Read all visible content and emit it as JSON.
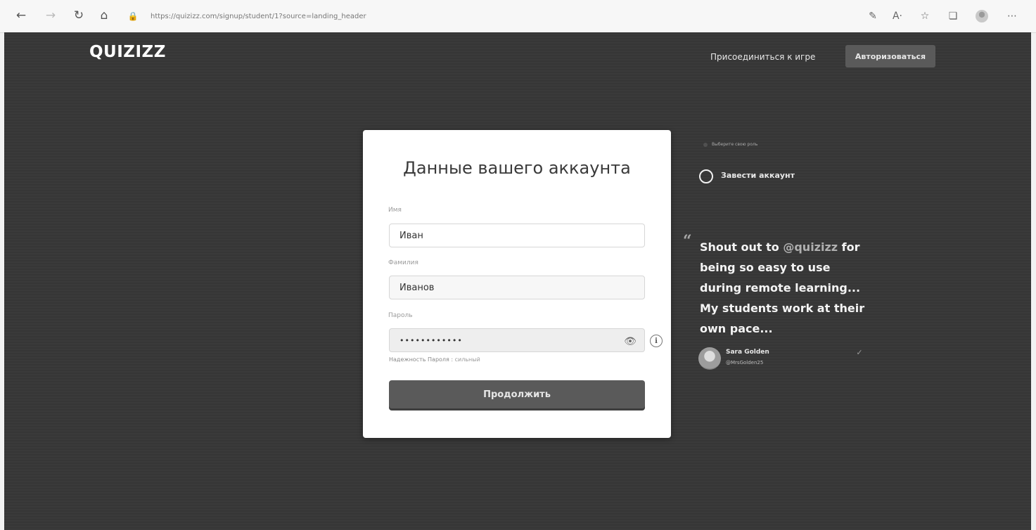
{
  "browser": {
    "url": "https://quizizz.com/signup/student/1?source=landing_header",
    "nav": {
      "back_icon": "arrow-left-icon",
      "forward_icon": "arrow-right-icon",
      "refresh_icon": "refresh-icon",
      "home_icon": "home-icon"
    },
    "toolbar_icons": [
      "pen-icon",
      "read-aloud-icon",
      "favorites-icon",
      "collections-icon",
      "profile-icon",
      "more-icon"
    ]
  },
  "header": {
    "logo": "QUIZIZZ",
    "join_link": "Присоединиться к игре",
    "login_button": "Авторизоваться"
  },
  "form": {
    "title": "Данные вашего аккаунта",
    "first_name_label": "Имя",
    "first_name_value": "Иван",
    "last_name_label": "Фамилия",
    "last_name_value": "Иванов",
    "password_label": "Пароль",
    "password_value": "••••••••••••",
    "strength_label": "Надежность Пароля :",
    "strength_value": "сильный",
    "continue_button": "Продолжить"
  },
  "steps": {
    "previous_step": "Выберите свою роль",
    "current_step": "Завести аккаунт"
  },
  "testimonial": {
    "quote_before": "Shout out to",
    "mention": "@quizizz",
    "quote_after": "for being so easy to use during remote learning... My students work at their own pace...",
    "author_name": "Sara Golden",
    "author_handle": "@MrsGolden25"
  }
}
